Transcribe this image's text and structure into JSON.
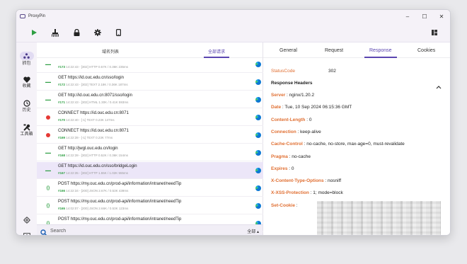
{
  "app": {
    "title": "ProxyPin"
  },
  "window_controls": {
    "minimize": "–",
    "maximize": "☐",
    "close": "✕"
  },
  "sidebar": {
    "items": [
      {
        "label": "抓包",
        "icon": "network-icon"
      },
      {
        "label": "收藏",
        "icon": "heart-icon"
      },
      {
        "label": "历史",
        "icon": "history-icon"
      },
      {
        "label": "工具箱",
        "icon": "tools-icon"
      }
    ]
  },
  "list": {
    "tabs": [
      "域名列表",
      "全部请求"
    ],
    "active_tab": 1,
    "rows": [
      {
        "title": "",
        "num": "#173",
        "meta": "14:22:43 - [302]  HTTP  0.57K / 0.36K  235ms",
        "status": "green",
        "edge": true,
        "selected": false
      },
      {
        "title": "GET https://id.ouc.edu.cn/sso/login",
        "num": "#172",
        "meta": "14:22:43 - [302]  TEXT  2.18K / 0.36K  187ms",
        "status": "green",
        "edge": true,
        "selected": false
      },
      {
        "title": "GET http://id.ouc.edu.cn:8071/sso/login",
        "num": "#171",
        "meta": "14:22:43 - [302]  HTML  1.30K / 0.41K  593ms",
        "status": "green",
        "edge": true,
        "selected": false
      },
      {
        "title": "CONNECT https://id.ouc.edu.cn:8071",
        "num": "#170",
        "meta": "14:22:40 - [-1]  TEXT  0.23K  147ms",
        "status": "red",
        "edge": true,
        "selected": false
      },
      {
        "title": "CONNECT https://id.ouc.edu.cn:8071",
        "num": "#169",
        "meta": "14:22:39 - [-1]  TEXT  0.23K  77ms",
        "status": "red",
        "edge": true,
        "selected": false
      },
      {
        "title": "GET http://jwgl.ouc.edu.cn/login",
        "num": "#168",
        "meta": "14:22:39 - [302]  HTTP  0.52K / 0.36K  154ms",
        "status": "green",
        "edge": true,
        "selected": false
      },
      {
        "title": "GET https://id.ouc.edu.cn/sso/bridgeLogin",
        "num": "#167",
        "meta": "14:22:35 - [302]  HTTP  1.55K / 1.02K  555ms",
        "status": "green",
        "edge": true,
        "selected": true
      },
      {
        "title": "POST https://my.ouc.edu.cn/prod-api/information/intranet/needTip",
        "num": "#166",
        "meta": "14:22:34 - [200]  JSON  2.67K / 0.53K  439ms",
        "status": "json",
        "edge": true,
        "selected": false
      },
      {
        "title": "POST https://my.ouc.edu.cn/prod-api/information/intranet/needTip",
        "num": "#165",
        "meta": "14:02:07 - [200]  JSON  2.66K / 0.53K  123ms",
        "status": "json",
        "edge": true,
        "selected": false
      },
      {
        "title": "POST https://my.ouc.edu.cn/prod-api/information/intranet/needTip",
        "num": "#164",
        "meta": "14:02:06 - [200]  JSON  2.66K / 0.53K  124ms",
        "status": "json",
        "edge": true,
        "selected": false
      },
      {
        "title": "POST https://my.ouc.edu.cn/prod-api/information/intranet/needTip",
        "num": "",
        "meta": "",
        "status": "json",
        "edge": false,
        "selected": false
      }
    ]
  },
  "search": {
    "placeholder": "Search",
    "filter": "全部"
  },
  "detail": {
    "tabs": [
      "General",
      "Request",
      "Response",
      "Cookies"
    ],
    "active_tab": 2,
    "status_key": "StatusCode",
    "status_value": "302",
    "headers_title": "Response Headers",
    "headers": [
      {
        "key": "Server",
        "value": "nginx/1.20.2"
      },
      {
        "key": "Date",
        "value": "Tue, 10 Sep 2024 06:15:36 GMT"
      },
      {
        "key": "Content-Length",
        "value": "0"
      },
      {
        "key": "Connection",
        "value": "keep-alive"
      },
      {
        "key": "Cache-Control",
        "value": "no-cache, no-store, max-age=0, must-revalidate"
      },
      {
        "key": "Pragma",
        "value": "no-cache"
      },
      {
        "key": "Expires",
        "value": "0"
      },
      {
        "key": "X-Content-Type-Options",
        "value": "nosniff"
      },
      {
        "key": "X-XSS-Protection",
        "value": "1; mode=block"
      },
      {
        "key": "Set-Cookie",
        "value": ""
      }
    ]
  },
  "colors": {
    "accent": "#5b46b0",
    "header_key": "#e06f32",
    "ok": "#2e9f43",
    "error": "#e53935"
  }
}
